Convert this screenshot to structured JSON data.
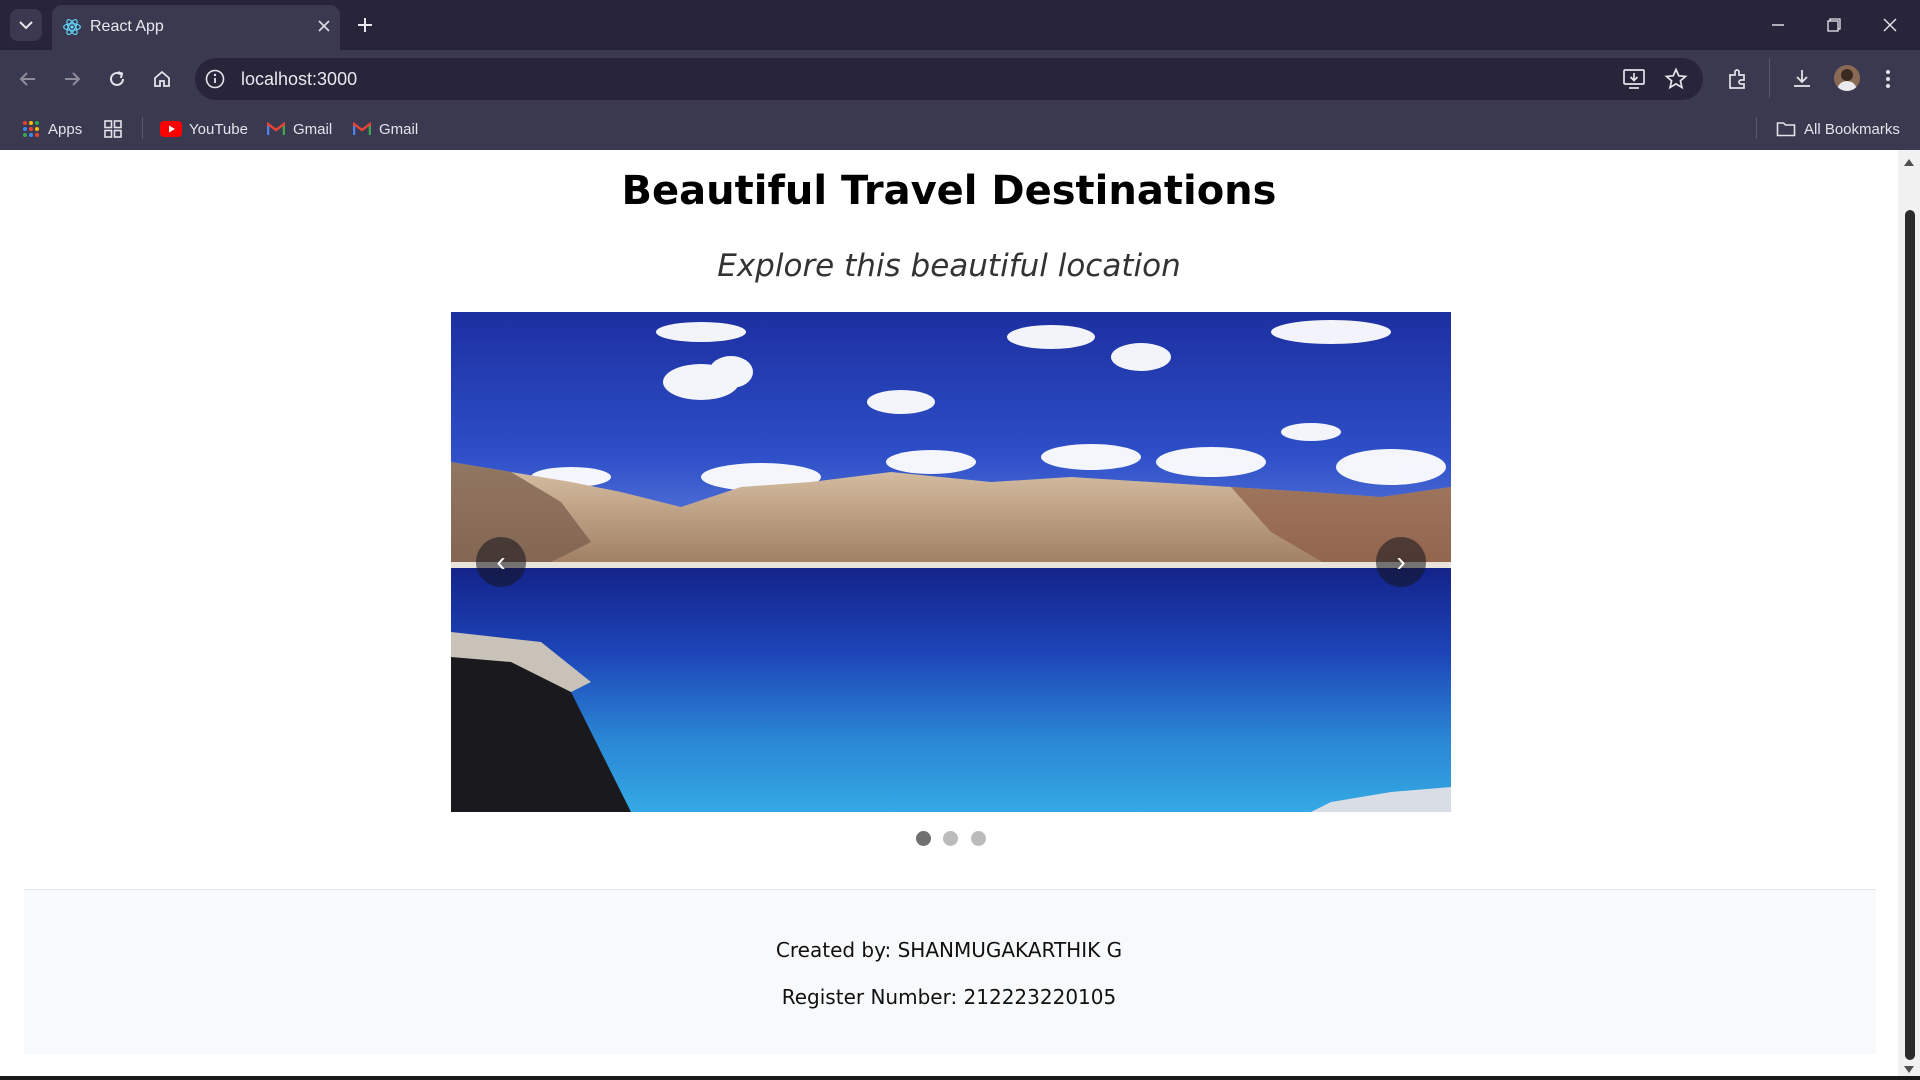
{
  "browser": {
    "tab_title": "React App",
    "url": "localhost:3000",
    "bookmarks": {
      "apps_label": "Apps",
      "items": [
        "YouTube",
        "Gmail",
        "Gmail"
      ],
      "all_bookmarks": "All Bookmarks"
    }
  },
  "page": {
    "title": "Beautiful Travel Destinations",
    "subtitle": "Explore this beautiful location",
    "carousel": {
      "prev_label": "‹",
      "next_label": "›",
      "active_slide": 1,
      "slide_count": 3
    },
    "footer": {
      "created_by": "Created by: SHANMUGAKARTHIK G",
      "register_number": "Register Number: 212223220105"
    }
  },
  "colors": {
    "titlebar": "#28253a",
    "toolbar": "#3b3950",
    "page_bg": "#ffffff",
    "footer_bg": "#f8f9fa",
    "dot_active": "#717171",
    "dot_inactive": "#bbbbbb"
  }
}
